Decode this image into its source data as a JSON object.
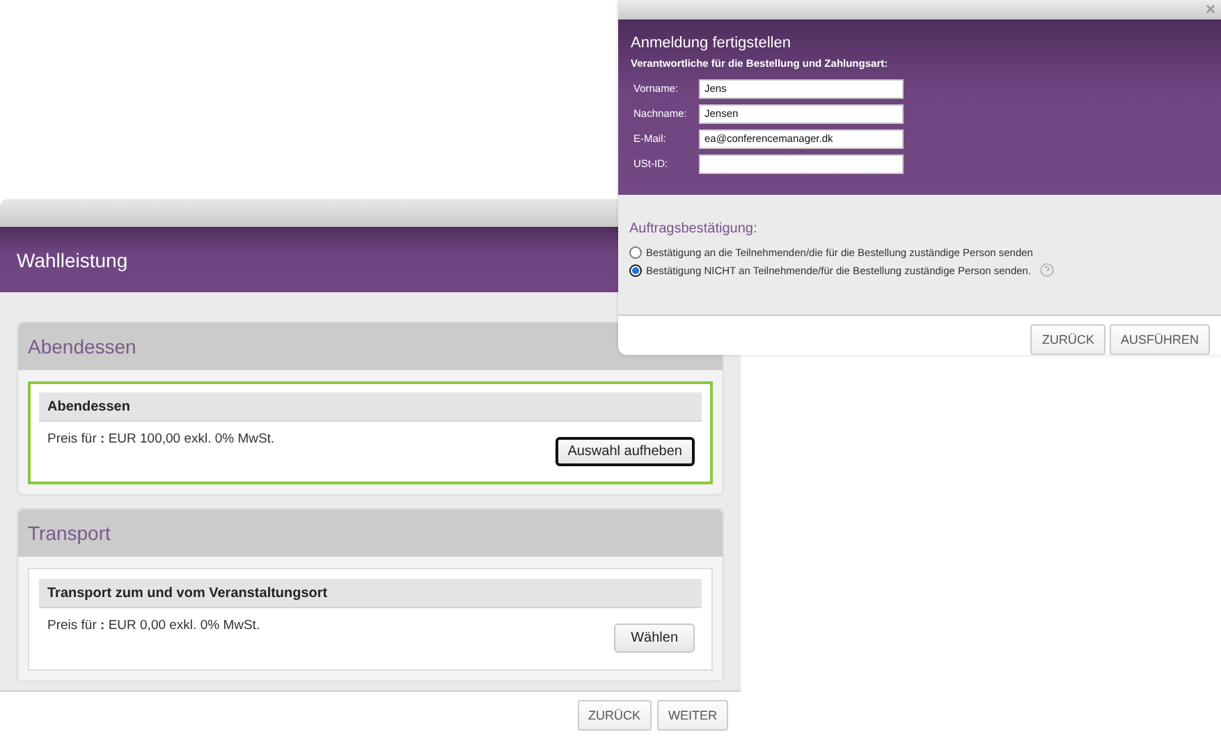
{
  "main_dialog": {
    "title": "Wahlleistung",
    "sections": [
      {
        "title": "Abendessen",
        "item": {
          "name": "Abendessen",
          "price": "Preis für **:** EUR 100,00 exkl. 0% MwSt.",
          "button": "Auswahl aufheben",
          "selected": true
        }
      },
      {
        "title": "Transport",
        "item": {
          "name": "Transport zum und vom Veranstaltungsort",
          "price": "Preis für **:** EUR 0,00 exkl. 0% MwSt.",
          "button": "Wählen",
          "selected": false
        }
      }
    ],
    "buttons": [
      "ZURÜCK",
      "WEITER"
    ]
  },
  "modal": {
    "title": "Anmeldung fertigstellen",
    "subtitle": "Verantwortliche für die Bestellung und Zahlungsart:",
    "fields": [
      {
        "label": "Vorname:",
        "value": "Jens"
      },
      {
        "label": "Nachname:",
        "value": "Jensen"
      },
      {
        "label": "E-Mail:",
        "value": "ea@conferencemanager.dk"
      },
      {
        "label": "USt-ID:"
      }
    ],
    "confirmation_heading": "Auftragsbestätigung:",
    "options": [
      {
        "label": "Bestätigung an die Teilnehmenden/die für die Bestellung zuständige Person senden",
        "selected": false,
        "help": false
      },
      {
        "label": "Bestätigung NICHT an Teilnehmende/für die Bestellung zuständige Person senden.",
        "selected": true,
        "help": true
      }
    ],
    "buttons": [
      "ZURÜCK",
      "AUSFÜHREN"
    ]
  }
}
